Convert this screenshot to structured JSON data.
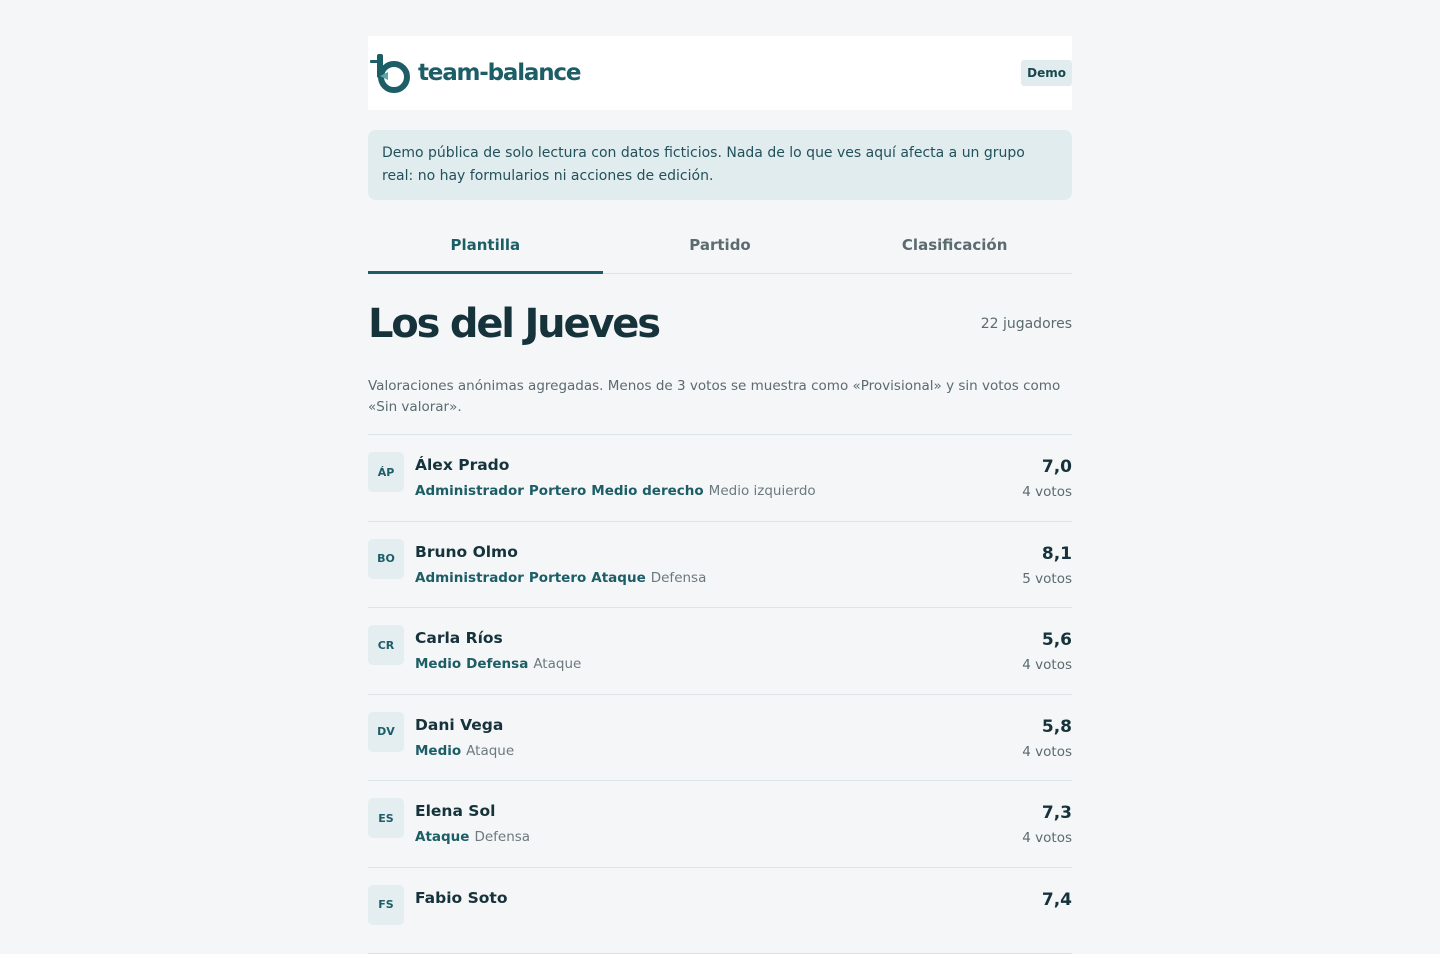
{
  "brand": {
    "name": "team-balance"
  },
  "header": {
    "badge": "Demo"
  },
  "notice": "Demo pública de solo lectura con datos ficticios. Nada de lo que ves aquí afecta a un grupo real: no hay formularios ni acciones de edición.",
  "tabs": [
    {
      "label": "Plantilla",
      "active": true
    },
    {
      "label": "Partido",
      "active": false
    },
    {
      "label": "Clasificación",
      "active": false
    }
  ],
  "group": {
    "title": "Los del Jueves",
    "count": "22 jugadores",
    "description": "Valoraciones anónimas agregadas. Menos de 3 votos se muestra como «Provisional» y sin votos como «Sin valorar»."
  },
  "players": [
    {
      "initials": "ÁP",
      "name": "Álex Prado",
      "tags_strong": [
        "Administrador",
        "Portero",
        "Medio derecho"
      ],
      "tags_weak": [
        "Medio izquierdo"
      ],
      "rating": "7,0",
      "votes": "4 votos"
    },
    {
      "initials": "BO",
      "name": "Bruno Olmo",
      "tags_strong": [
        "Administrador",
        "Portero",
        "Ataque"
      ],
      "tags_weak": [
        "Defensa"
      ],
      "rating": "8,1",
      "votes": "5 votos"
    },
    {
      "initials": "CR",
      "name": "Carla Ríos",
      "tags_strong": [
        "Medio",
        "Defensa"
      ],
      "tags_weak": [
        "Ataque"
      ],
      "rating": "5,6",
      "votes": "4 votos"
    },
    {
      "initials": "DV",
      "name": "Dani Vega",
      "tags_strong": [
        "Medio"
      ],
      "tags_weak": [
        "Ataque"
      ],
      "rating": "5,8",
      "votes": "4 votos"
    },
    {
      "initials": "ES",
      "name": "Elena Sol",
      "tags_strong": [
        "Ataque"
      ],
      "tags_weak": [
        "Defensa"
      ],
      "rating": "7,3",
      "votes": "4 votos"
    },
    {
      "initials": "FS",
      "name": "Fabio Soto",
      "tags_strong": [],
      "tags_weak": [],
      "rating": "7,4",
      "votes": ""
    }
  ],
  "colors": {
    "accent": "#1c5d66",
    "text": "#16323a",
    "muted": "#5b6b70",
    "notice_bg": "#e1ecee"
  }
}
